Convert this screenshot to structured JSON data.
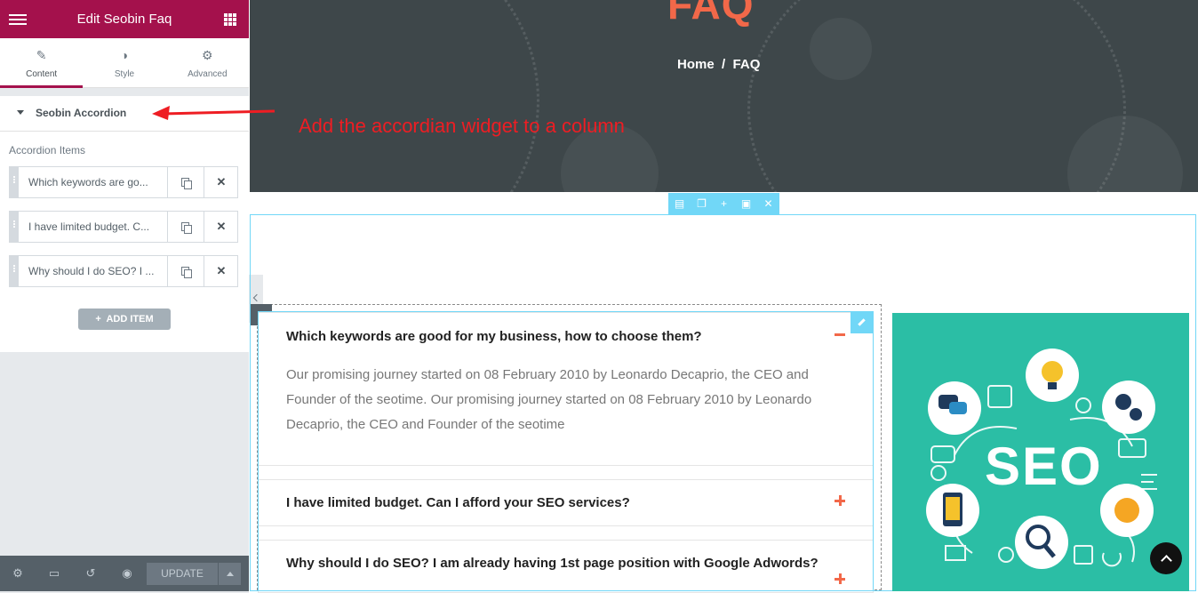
{
  "panel": {
    "header_title": "Edit Seobin Faq",
    "tabs": [
      {
        "label": "Content",
        "icon": "pencil-icon"
      },
      {
        "label": "Style",
        "icon": "contrast-icon"
      },
      {
        "label": "Advanced",
        "icon": "gear-icon"
      }
    ],
    "section_title": "Seobin Accordion",
    "items_label": "Accordion Items",
    "repeater_items": [
      "Which keywords are go...",
      "I have limited budget. C...",
      "Why should I do SEO? I ..."
    ],
    "add_item_label": "ADD ITEM",
    "update_label": "UPDATE"
  },
  "hero": {
    "title": "FAQ",
    "breadcrumb_home": "Home",
    "breadcrumb_sep": "/",
    "breadcrumb_current": "FAQ"
  },
  "annotation": "Add the accordian widget to a column",
  "accordion": {
    "items": [
      {
        "question": "Which keywords are good for my business, how to choose them?",
        "answer": "Our promising journey started on 08 February 2010 by Leonardo Decaprio, the CEO and Founder of the seotime. Our promising journey started on 08 February 2010 by Leonardo Decaprio, the CEO and Founder of the seotime",
        "expanded": true
      },
      {
        "question": "I have limited budget. Can I afford your SEO services?",
        "expanded": false
      },
      {
        "question": "Why should I do SEO? I am already having 1st page position with Google Adwords?",
        "expanded": false
      }
    ]
  },
  "seo_image": {
    "text": "SEO"
  },
  "colors": {
    "brand": "#a4114c",
    "accent_orange": "#f26849",
    "editor_blue": "#71d7f7",
    "seo_teal": "#2bbea5",
    "annotation_red": "#ee1d23"
  }
}
